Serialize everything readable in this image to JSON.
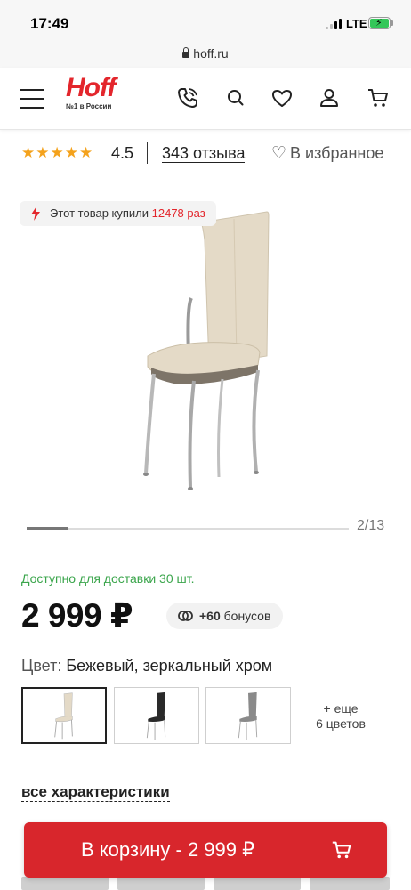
{
  "status_bar": {
    "time": "17:49",
    "network": "LTE",
    "battery_level": 1.0,
    "battery_color": "#34c759"
  },
  "browser": {
    "url": "hoff.ru",
    "lock_icon": "lock-icon"
  },
  "header": {
    "logo_text": "Hoff",
    "logo_tagline": "№1 в России",
    "brand_color": "#e3262c",
    "icons": [
      "menu-icon",
      "phone-icon",
      "search-icon",
      "heart-icon",
      "user-icon",
      "cart-icon"
    ]
  },
  "rating": {
    "stars": "★★★★★",
    "value": "4.5",
    "reviews": "343 отзыва",
    "favorite_label": "В избранное"
  },
  "badge": {
    "prefix": "Этот товар купили",
    "count": "12478 раз"
  },
  "gallery": {
    "current": 2,
    "total": 13,
    "counter": "2/13"
  },
  "availability": "Доступно для доставки 30 шт.",
  "price": "2 999 ₽",
  "bonus": {
    "amount": "+60",
    "label": "бонусов"
  },
  "color": {
    "label": "Цвет:",
    "value": "Бежевый, зеркальный хром",
    "swatches": [
      {
        "name": "beige",
        "seat": "#e4dac7",
        "active": true
      },
      {
        "name": "black",
        "seat": "#2a2a2a",
        "active": false
      },
      {
        "name": "grey",
        "seat": "#8a8a8a",
        "active": false
      }
    ],
    "more_line1": "+ еще",
    "more_line2": "6 цветов"
  },
  "specs_link": "все характеристики",
  "cart_button": {
    "label": "В корзину - 2 999 ₽",
    "color": "#d8262c"
  }
}
